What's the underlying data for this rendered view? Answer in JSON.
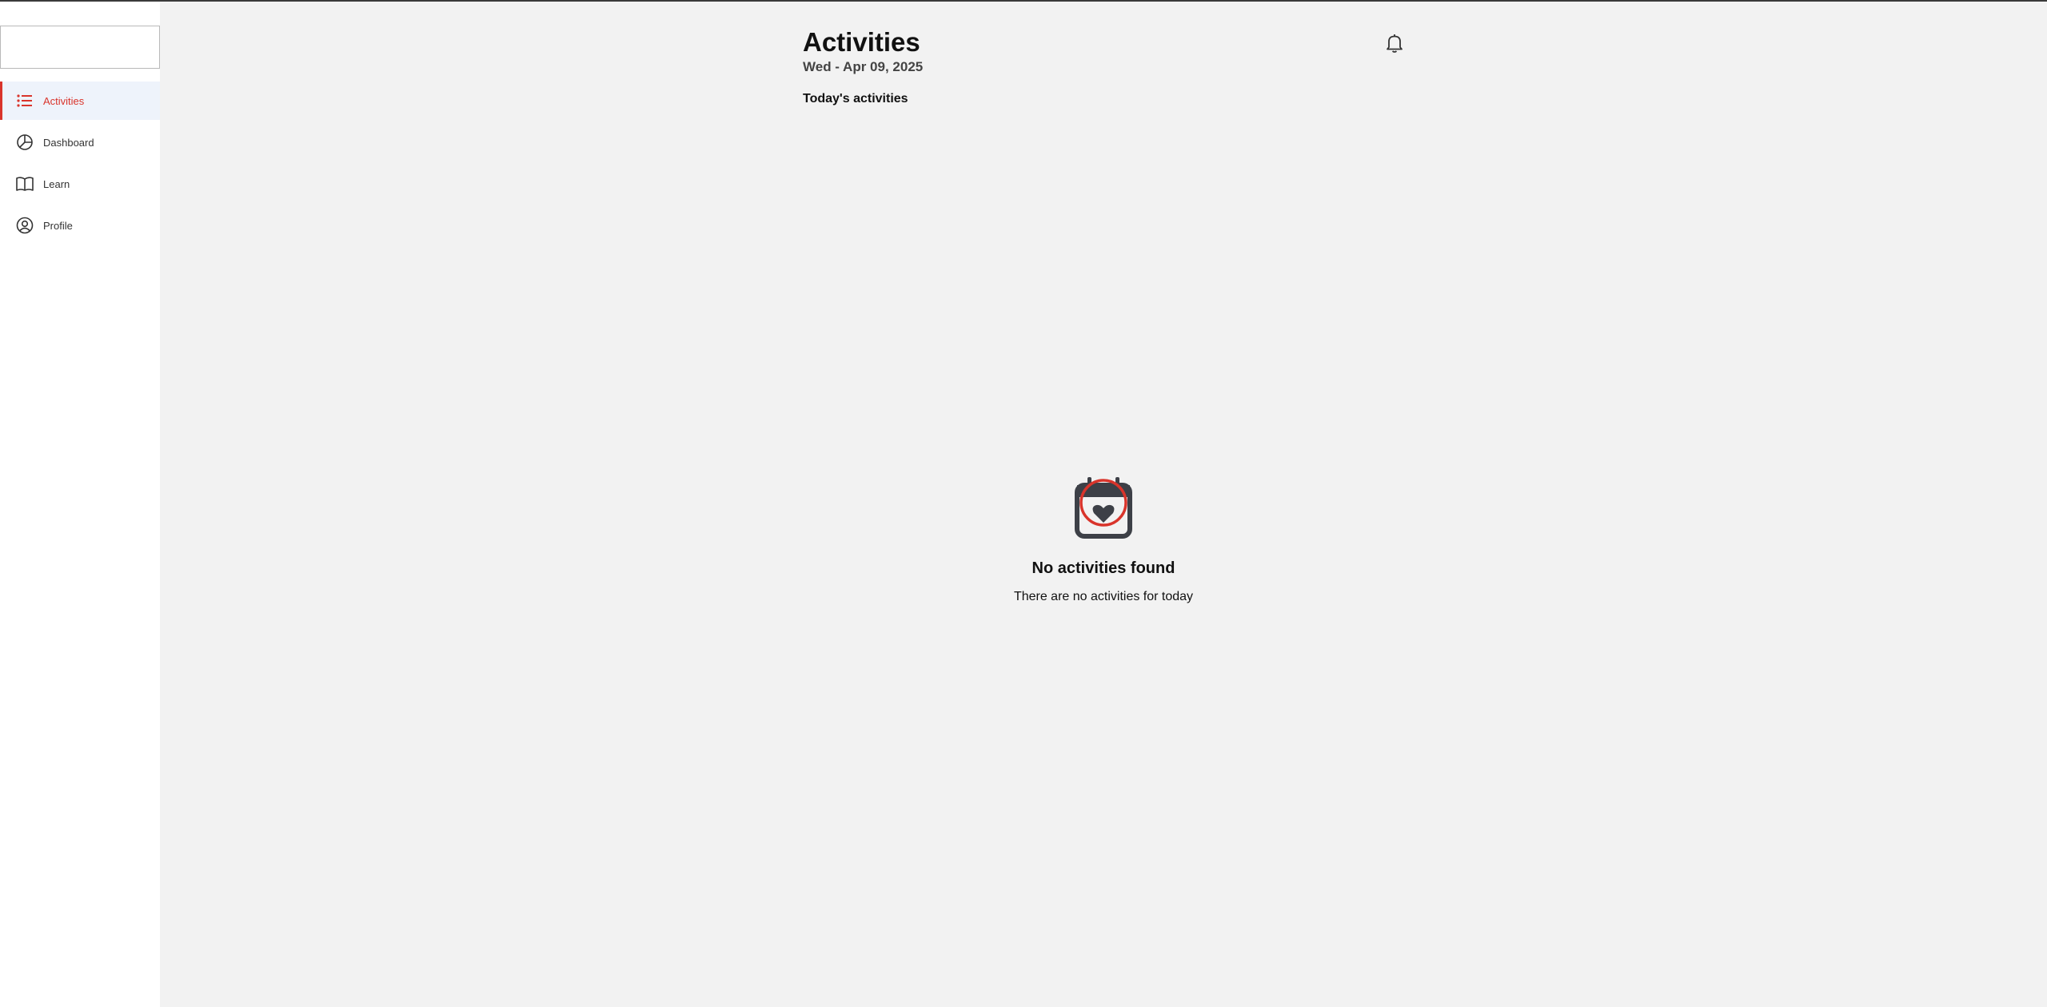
{
  "sidebar": {
    "items": [
      {
        "label": "Activities",
        "icon": "list-icon",
        "active": true
      },
      {
        "label": "Dashboard",
        "icon": "pie-chart-icon",
        "active": false
      },
      {
        "label": "Learn",
        "icon": "book-icon",
        "active": false
      },
      {
        "label": "Profile",
        "icon": "user-circle-icon",
        "active": false
      }
    ]
  },
  "header": {
    "title": "Activities",
    "date": "Wed - Apr 09, 2025",
    "section": "Today's activities"
  },
  "empty_state": {
    "title": "No activities found",
    "subtitle": "There are no activities for today"
  },
  "colors": {
    "accent": "#d9342b",
    "active_bg": "#eef3fb",
    "page_bg": "#f2f2f2",
    "icon_dark": "#3d4047"
  }
}
